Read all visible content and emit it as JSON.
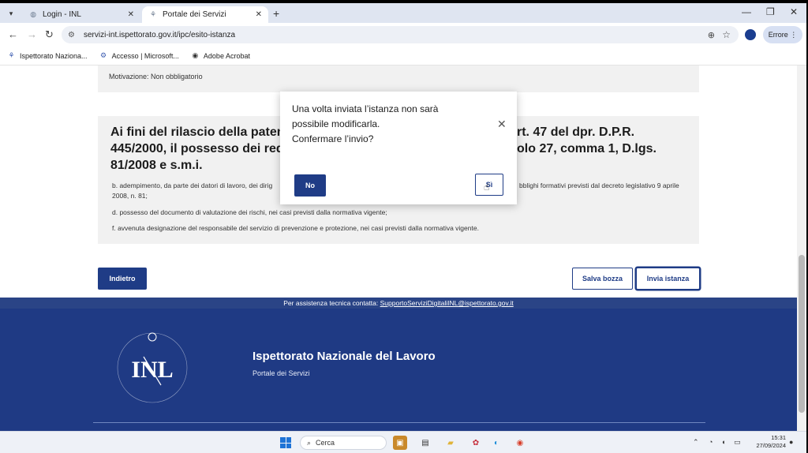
{
  "browser": {
    "tabs": [
      {
        "title": "Login - INL",
        "active": false
      },
      {
        "title": "Portale dei Servizi",
        "active": true
      }
    ],
    "url": "servizi-int.ispettorato.gov.it/ipc/esito-istanza",
    "profile_button": "Errore",
    "bookmarks": [
      {
        "label": "Ispettorato Naziona...",
        "icon": "inl-icon"
      },
      {
        "label": "Accesso | Microsoft...",
        "icon": "gear-icon"
      },
      {
        "label": "Adobe Acrobat",
        "icon": "globe-icon"
      }
    ]
  },
  "page": {
    "motivazione": "Motivazione: Non obbligatorio",
    "section_heading_left_1": "Ai fini del rilascio della patente",
    "section_heading_left_2": "445/2000, il possesso dei requ",
    "section_heading_left_3": "81/2008 e s.m.i.",
    "section_heading_right_1": "rt. 47 del dpr. D.P.R.",
    "section_heading_right_2": "olo 27, comma 1, D.lgs.",
    "item_b_left": "b. adempimento, da parte dei datori di lavoro, dei dirig",
    "item_b_right": "bblighi formativi previsti dal decreto legislativo 9 aprile",
    "item_b_cont": "2008, n. 81;",
    "item_d": "d. possesso del documento di valutazione dei rischi, nei casi previsti dalla normativa vigente;",
    "item_f": "f. avvenuta designazione del responsabile del servizio di prevenzione e protezione, nei casi previsti dalla normativa vigente.",
    "buttons": {
      "indietro": "Indietro",
      "salva_bozza": "Salva bozza",
      "invia_istanza": "Invia istanza"
    },
    "assist_text": "Per assistenza tecnica contatta: ",
    "assist_email": "SupportoServiziDigitaliINL@ispettorato.gov.it",
    "footer": {
      "org_name": "Ispettorato Nazionale del Lavoro",
      "portal": "Portale dei Servizi",
      "logo_text": "ISPETTORATO NAZIONALE DEL LAVORO"
    }
  },
  "modal": {
    "message_1": "Una volta inviata l’istanza non sarà",
    "message_2": "possibile modificarla.",
    "message_3": "Confermare l’invio?",
    "no_label": "No",
    "si_label": "Sì"
  },
  "taskbar": {
    "search_placeholder": "Cerca",
    "time": "15:31",
    "date": "27/09/2024"
  },
  "colors": {
    "primary": "#1f3c86",
    "footer": "#1f3a84",
    "panel": "#f1f1f1"
  }
}
